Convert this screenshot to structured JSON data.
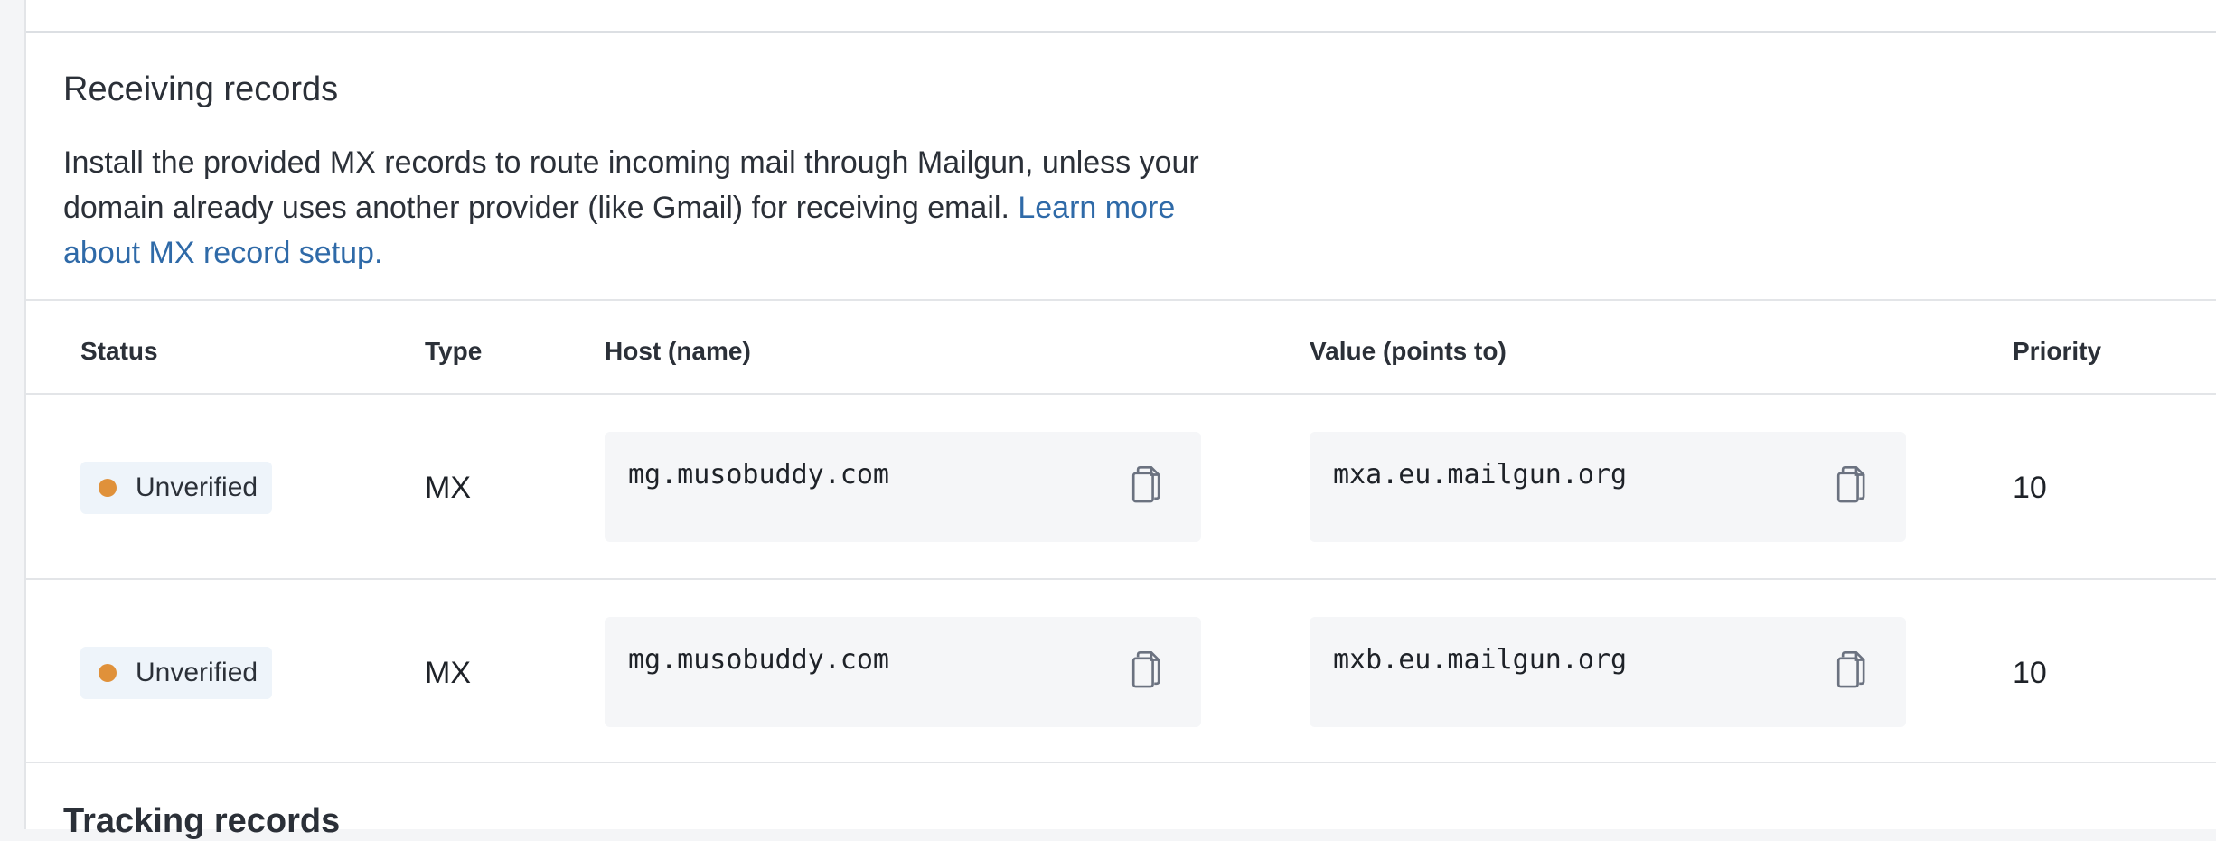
{
  "section": {
    "title": "Receiving records",
    "description": "Install the provided MX records to route incoming mail through Mailgun, unless your domain already uses another provider (like Gmail) for receiving email.",
    "link_text": "Learn more about MX record setup."
  },
  "table": {
    "headers": {
      "status": "Status",
      "type": "Type",
      "host": "Host (name)",
      "value": "Value (points to)",
      "priority": "Priority"
    },
    "rows": [
      {
        "status": "Unverified",
        "type": "MX",
        "host": "mg.musobuddy.com",
        "value": "mxa.eu.mailgun.org",
        "priority": "10"
      },
      {
        "status": "Unverified",
        "type": "MX",
        "host": "mg.musobuddy.com",
        "value": "mxb.eu.mailgun.org",
        "priority": "10"
      }
    ]
  },
  "next_section": {
    "title": "Tracking records"
  },
  "colors": {
    "link": "#2f6aa8",
    "status_unverified_dot": "#e0913a",
    "badge_bg": "#eef4fa",
    "code_bg": "#f5f6f8"
  },
  "icons": {
    "copy": "copy-icon",
    "status_dot": "status-dot-icon"
  }
}
